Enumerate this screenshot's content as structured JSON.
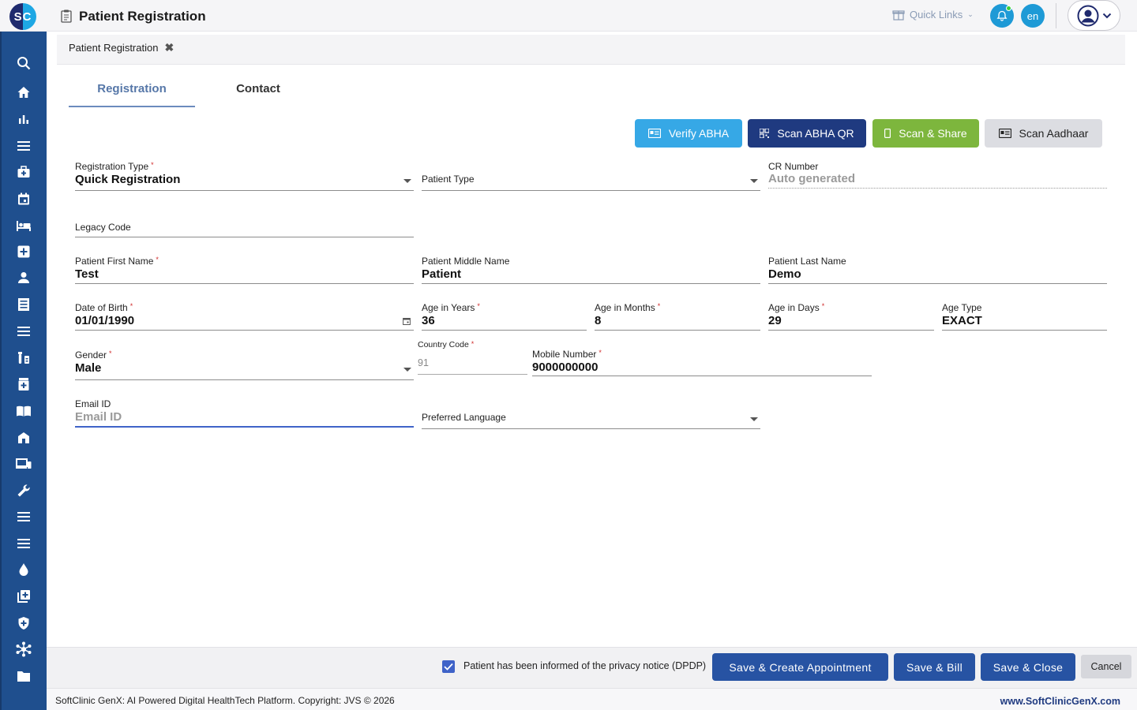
{
  "header": {
    "logo_text": "SC",
    "title": "Patient Registration",
    "quick_links_label": "Quick Links",
    "language": "en"
  },
  "breadcrumb": {
    "label": "Patient Registration",
    "close_glyph": "✖"
  },
  "tabs": [
    {
      "label": "Registration",
      "active": true
    },
    {
      "label": "Contact",
      "active": false
    }
  ],
  "actions": {
    "verify_abha": "Verify ABHA",
    "scan_abha_qr": "Scan ABHA QR",
    "scan_share": "Scan & Share",
    "scan_aadhaar": "Scan Aadhaar"
  },
  "form": {
    "registration_type": {
      "label": "Registration Type",
      "value": "Quick Registration"
    },
    "patient_type": {
      "label": "Patient Type",
      "value": ""
    },
    "cr_number": {
      "label": "CR Number",
      "placeholder": "Auto generated"
    },
    "legacy_code": {
      "label": "Legacy Code",
      "value": ""
    },
    "first_name": {
      "label": "Patient First Name",
      "value": "Test"
    },
    "middle_name": {
      "label": "Patient Middle Name",
      "value": "Patient"
    },
    "last_name": {
      "label": "Patient Last Name",
      "value": "Demo"
    },
    "dob": {
      "label": "Date of Birth",
      "value": "01/01/1990"
    },
    "age_years": {
      "label": "Age in Years",
      "value": "36"
    },
    "age_months": {
      "label": "Age in Months",
      "value": "8"
    },
    "age_days": {
      "label": "Age in Days",
      "value": "29"
    },
    "age_type": {
      "label": "Age Type",
      "value": "EXACT"
    },
    "gender": {
      "label": "Gender",
      "value": "Male"
    },
    "country_code": {
      "label": "Country Code",
      "value": "91"
    },
    "mobile": {
      "label": "Mobile Number",
      "value": "9000000000"
    },
    "email": {
      "label": "Email ID",
      "placeholder": "Email ID"
    },
    "preferred_language": {
      "label": "Preferred Language",
      "value": ""
    }
  },
  "footer": {
    "dpdp_label": "Patient has been informed of the privacy notice (DPDP)",
    "dpdp_checked": true,
    "save_appointment": "Save & Create Appointment",
    "save_bill": "Save & Bill",
    "save_close": "Save & Close",
    "cancel": "Cancel",
    "copyright": "SoftClinic GenX: AI Powered Digital HealthTech Platform. Copyright: JVS © 2026",
    "website": "www.SoftClinicGenX.com"
  },
  "colors": {
    "sidebar": "#1f4f8e",
    "primary_button": "#2753a3",
    "verify_button": "#36a8e6",
    "qr_button": "#1f3a80",
    "share_button": "#7db63d",
    "required_marker": "#d12d2d"
  }
}
